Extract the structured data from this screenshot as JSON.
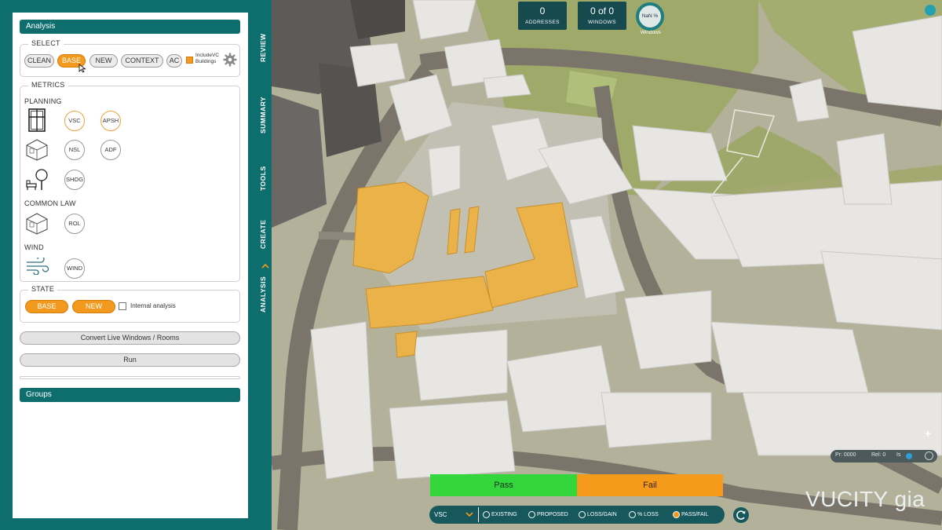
{
  "analysis_header": "Analysis",
  "select": {
    "title": "SELECT",
    "buttons": [
      "CLEAN",
      "BASE",
      "NEW",
      "CONTEXT",
      "AC"
    ],
    "active": "BASE",
    "include_vc_label": "IncludeVC\nBuildings"
  },
  "metrics": {
    "title": "METRICS",
    "planning_label": "PLANNING",
    "common_law_label": "COMMON LAW",
    "wind_label": "WIND",
    "planning_metrics": [
      "VSC",
      "APSH",
      "NSL",
      "ADF",
      "SHOG"
    ],
    "common_law_metrics": [
      "ROL"
    ],
    "wind_metrics": [
      "WIND"
    ]
  },
  "state": {
    "title": "STATE",
    "buttons": [
      "BASE",
      "NEW"
    ],
    "internal_analysis_label": "Internal analysis"
  },
  "convert_button": "Convert Live Windows / Rooms",
  "run_button": "Run",
  "groups_header": "Groups",
  "side_tabs": [
    "REVIEW",
    "SUMMARY",
    "TOOLS",
    "CREATE",
    "ANALYSIS"
  ],
  "hud": {
    "addresses_value": "0",
    "addresses_label": "ADDRESSES",
    "windows_value": "0 of 0",
    "windows_label": "WINDOWS",
    "nan_label": "NaN %",
    "nan_sub": "Windows"
  },
  "legend": {
    "pass": "Pass",
    "fail": "Fail"
  },
  "bottom_bar": {
    "metric_select": "VSC",
    "options": [
      "EXISTING",
      "PROPOSED",
      "LOSS/GAIN",
      "% LOSS",
      "PASS/FAIL"
    ],
    "selected": "PASS/FAIL"
  },
  "status_readout": {
    "pr": "Pr: 0000",
    "rel": "Rel: 0",
    "is": "Is"
  },
  "logo": "VUCITY gia",
  "colors": {
    "teal": "#0e6e6e",
    "orange": "#f39a1e",
    "pass": "#33d63b",
    "fail": "#f59a1a"
  }
}
